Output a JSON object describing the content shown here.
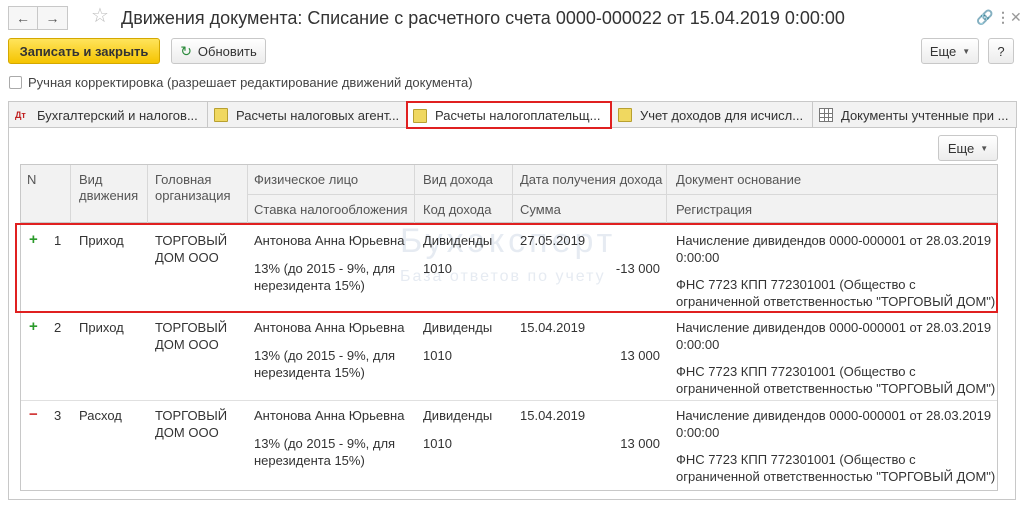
{
  "window": {
    "title": "Движения документа: Списание с расчетного счета 0000-000022 от 15.04.2019 0:00:00",
    "back_icon": "arrow-left-icon",
    "forward_icon": "arrow-right-icon",
    "star_icon": "star-icon",
    "link_glyph": "🔗",
    "menu_glyph": "⋮",
    "close_glyph": "✕"
  },
  "toolbar": {
    "save_close_label": "Записать и закрыть",
    "refresh_label": "Обновить",
    "more_label": "Еще",
    "help_label": "?"
  },
  "manual_correction": {
    "label": "Ручная корректировка (разрешает редактирование движений документа)",
    "checked": false
  },
  "tabs": [
    {
      "label": "Бухгалтерский и налогов...",
      "icon": "accounting-icon"
    },
    {
      "label": "Расчеты налоговых агент...",
      "icon": "document-icon"
    },
    {
      "label": "Расчеты налогоплательщ...",
      "icon": "document-icon",
      "active": true
    },
    {
      "label": "Учет доходов для исчисл...",
      "icon": "document-icon"
    },
    {
      "label": "Документы учтенные при ...",
      "icon": "table-icon"
    }
  ],
  "panel": {
    "more_label": "Еще"
  },
  "table": {
    "headers": {
      "n": "N",
      "movement_type": "Вид движения",
      "org": "Головная организация",
      "person": "Физическое лицо",
      "tax_rate": "Ставка налогообложения",
      "income_type": "Вид дохода",
      "income_code": "Код дохода",
      "income_date": "Дата получения дохода",
      "amount": "Сумма",
      "basis_doc": "Документ основание",
      "registration": "Регистрация"
    },
    "rows": [
      {
        "sign": "+",
        "n": "1",
        "movement_type": "Приход",
        "org_line1": "ТОРГОВЫЙ",
        "org_line2": "ДОМ ООО",
        "person": "Антонова Анна Юрьевна",
        "rate_line1": "13% (до 2015 - 9%, для",
        "rate_line2": "нерезидента 15%)",
        "income_type": "Дивиденды",
        "income_code": "1010",
        "date": "27.05.2019",
        "amount": "-13 000",
        "basis_line1": "Начисление дивидендов 0000-000001 от 28.03.2019",
        "basis_line2": "0:00:00",
        "reg_line1": "ФНС 7723 КПП 772301001 (Общество с",
        "reg_line2": "ограниченной ответственностью \"ТОРГОВЫЙ ДОМ\")"
      },
      {
        "sign": "+",
        "n": "2",
        "movement_type": "Приход",
        "org_line1": "ТОРГОВЫЙ",
        "org_line2": "ДОМ ООО",
        "person": "Антонова Анна Юрьевна",
        "rate_line1": "13% (до 2015 - 9%, для",
        "rate_line2": "нерезидента 15%)",
        "income_type": "Дивиденды",
        "income_code": "1010",
        "date": "15.04.2019",
        "amount": "13 000",
        "basis_line1": "Начисление дивидендов 0000-000001 от 28.03.2019",
        "basis_line2": "0:00:00",
        "reg_line1": "ФНС 7723 КПП 772301001 (Общество с",
        "reg_line2": "ограниченной ответственностью \"ТОРГОВЫЙ ДОМ\")"
      },
      {
        "sign": "−",
        "n": "3",
        "movement_type": "Расход",
        "org_line1": "ТОРГОВЫЙ",
        "org_line2": "ДОМ ООО",
        "person": "Антонова Анна Юрьевна",
        "rate_line1": "13% (до 2015 - 9%, для",
        "rate_line2": "нерезидента 15%)",
        "income_type": "Дивиденды",
        "income_code": "1010",
        "date": "15.04.2019",
        "amount": "13 000",
        "basis_line1": "Начисление дивидендов 0000-000001 от 28.03.2019",
        "basis_line2": "0:00:00",
        "reg_line1": "ФНС 7723 КПП 772301001 (Общество с",
        "reg_line2": "ограниченной ответственностью \"ТОРГОВЫЙ ДОМ\")"
      }
    ]
  },
  "watermark": {
    "logo": "Бухэксперт",
    "tagline": "База ответов по учету"
  },
  "colors": {
    "primary_button": "#f5c400",
    "highlight": "#e02020",
    "plus": "#2a9a2a",
    "minus": "#d03030"
  }
}
